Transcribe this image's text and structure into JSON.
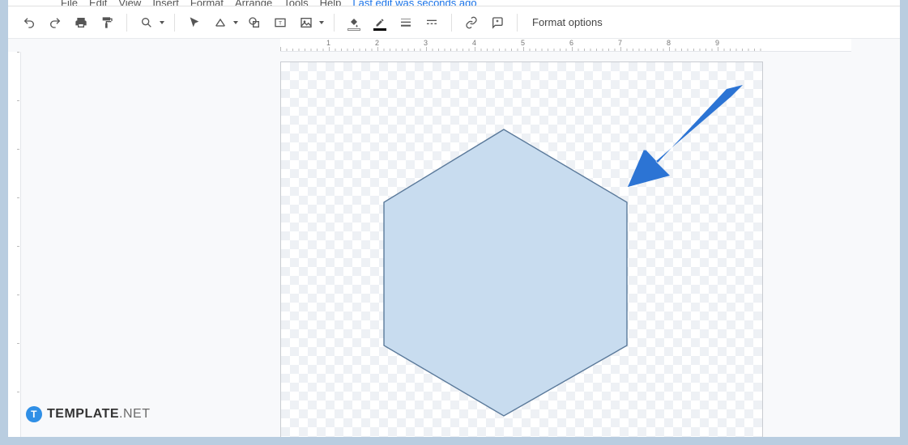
{
  "menu": {
    "items": [
      "File",
      "Edit",
      "View",
      "Insert",
      "Format",
      "Arrange",
      "Tools",
      "Help"
    ],
    "last_edit": "Last edit was seconds ago"
  },
  "toolbar": {
    "undo": "undo",
    "redo": "redo",
    "print": "print",
    "paint": "paint-format",
    "zoom": "zoom",
    "select": "select",
    "line": "line",
    "shape": "shape",
    "textbox": "textbox",
    "image": "image",
    "fill": "fill-color",
    "border_color": "border-color",
    "border_weight": "border-weight",
    "border_dash": "border-dash",
    "link": "link",
    "comment": "comment",
    "format_options": "Format options"
  },
  "ruler": {
    "labels": [
      "1",
      "2",
      "3",
      "4",
      "5",
      "6",
      "7",
      "8",
      "9"
    ]
  },
  "canvas": {
    "shape": "hexagon",
    "fill": "#c8dcef",
    "stroke": "#5b7a9b"
  },
  "annotation": {
    "type": "arrow",
    "color": "#2c74d4"
  },
  "watermark": {
    "brand_bold": "TEMPLATE",
    "brand_thin": ".NET",
    "badge": "T"
  }
}
